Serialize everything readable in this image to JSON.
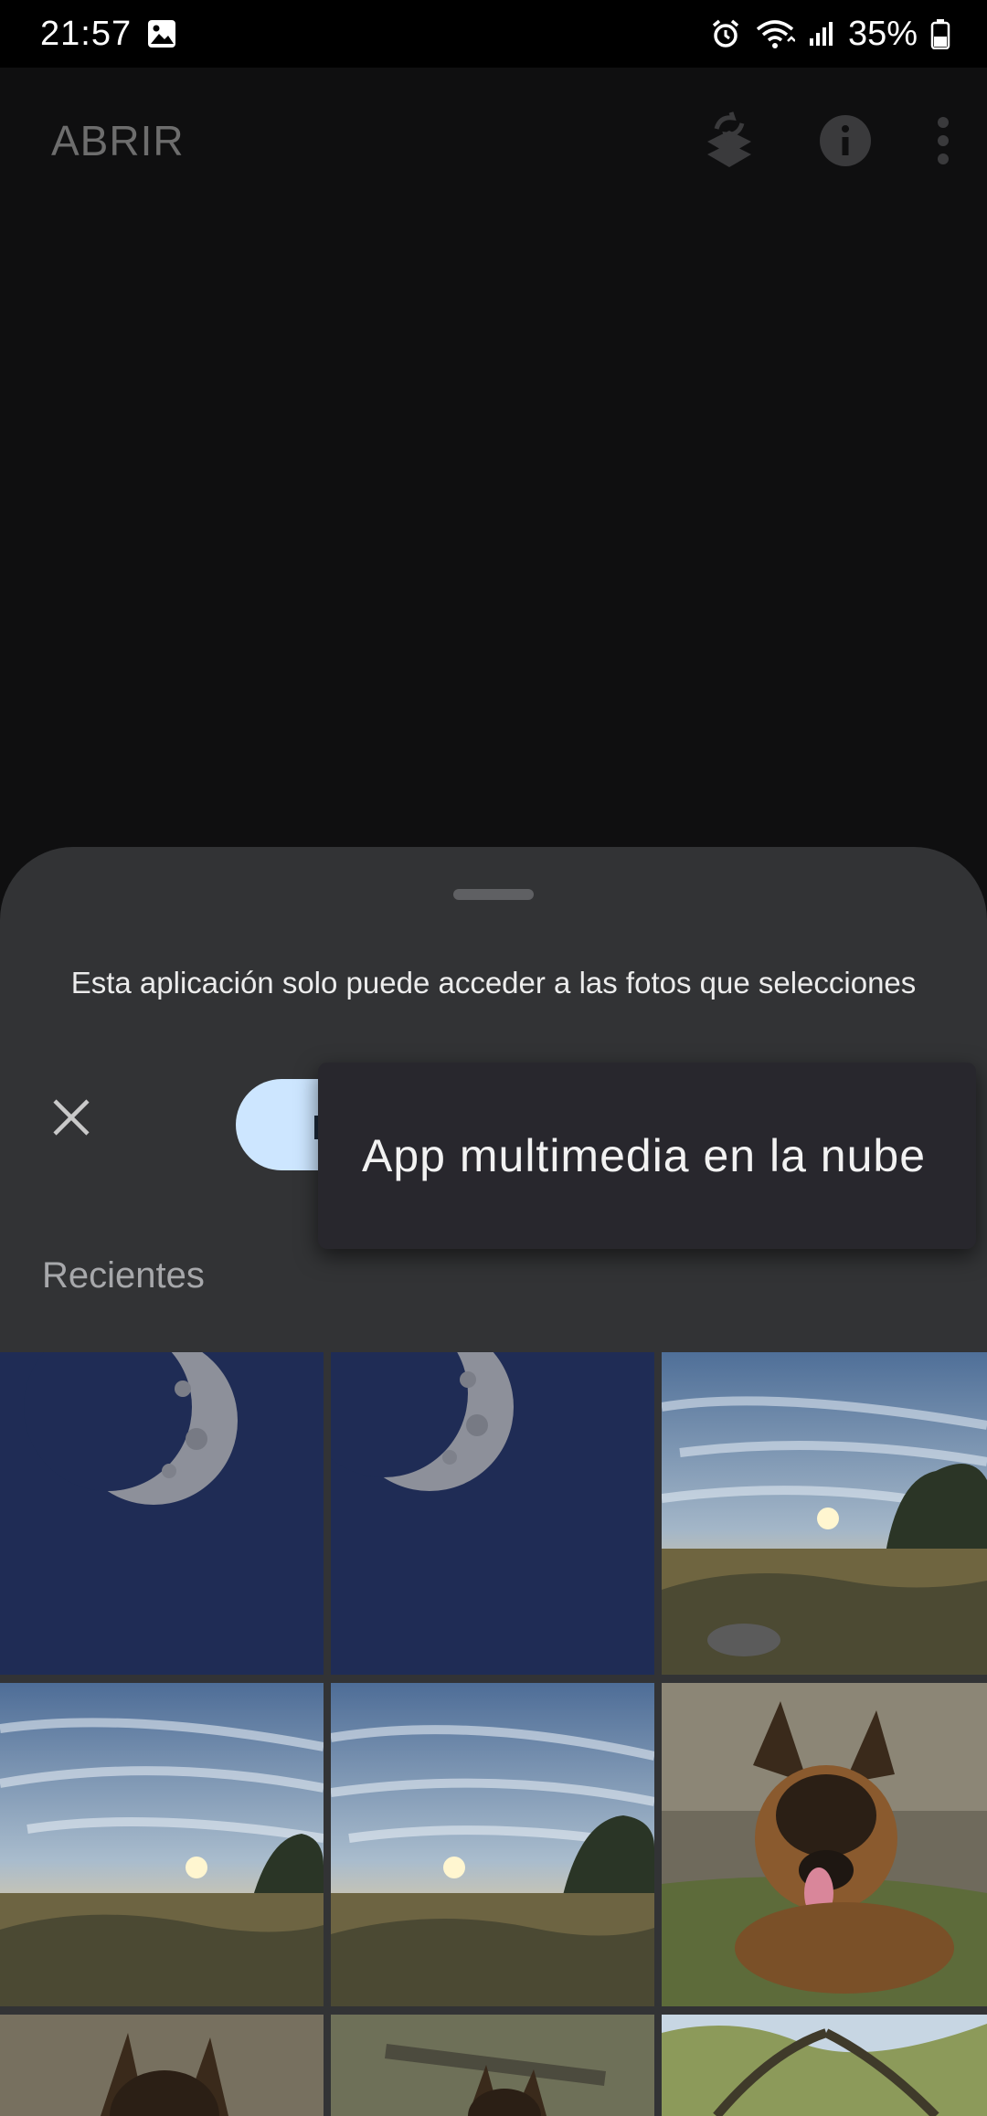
{
  "status_bar": {
    "time": "21:57",
    "battery_percent": "35%",
    "icons": [
      "gallery-notification-icon",
      "alarm-icon",
      "wifi-icon",
      "signal-icon",
      "battery-icon"
    ]
  },
  "app_bar": {
    "title": "ABRIR",
    "actions": [
      "layers-icon",
      "info-icon",
      "more-vert-icon"
    ]
  },
  "sheet": {
    "message": "Esta aplicación solo puede acceder a las fotos que selecciones",
    "close_icon": "close-icon",
    "section_label": "Recientes"
  },
  "popup_menu": {
    "items": [
      {
        "label": "App multimedia en la nube"
      }
    ]
  },
  "photos": [
    {
      "subject": "moon"
    },
    {
      "subject": "moon"
    },
    {
      "subject": "sunset-landscape"
    },
    {
      "subject": "sunset-landscape"
    },
    {
      "subject": "sunset-landscape"
    },
    {
      "subject": "dog"
    },
    {
      "subject": "dog"
    },
    {
      "subject": "dog"
    },
    {
      "subject": "tree"
    }
  ],
  "colors": {
    "background": "#0f0f10",
    "sheet": "#323335",
    "popup": "#28272d",
    "accent_button": "#cde6ff"
  }
}
